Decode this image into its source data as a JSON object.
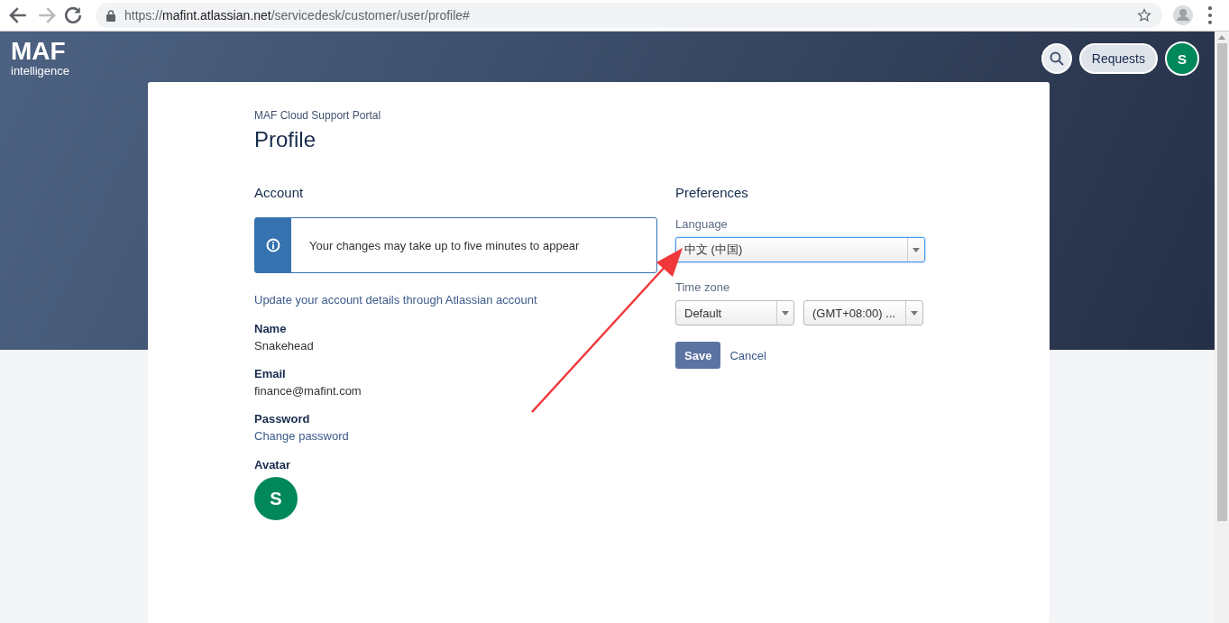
{
  "browser": {
    "url": {
      "scheme": "https://",
      "host": "mafint.atlassian.net",
      "path": "/servicedesk/customer/user/profile#"
    }
  },
  "header": {
    "logo": {
      "mark": "MAF",
      "tagline": "intelligence"
    },
    "requests_button": "Requests",
    "avatar_initial": "S"
  },
  "card": {
    "portal_name": "MAF Cloud Support Portal",
    "title": "Profile",
    "account": {
      "heading": "Account",
      "notice": "Your changes may take up to five minutes to appear",
      "update_link": "Update your account details through Atlassian account",
      "fields": [
        {
          "kind": "text",
          "label": "Name",
          "value": "Snakehead"
        },
        {
          "kind": "text",
          "label": "Email",
          "value": "finance@mafint.com"
        },
        {
          "kind": "link",
          "label": "Password",
          "value": "Change password"
        },
        {
          "kind": "avatar",
          "label": "Avatar",
          "value": "S"
        }
      ]
    },
    "preferences": {
      "heading": "Preferences",
      "language": {
        "label": "Language",
        "value": "中文 (中国)",
        "focused": true
      },
      "time_zone": {
        "label": "Time zone",
        "region": "Default",
        "zone": "(GMT+08:00) ..."
      },
      "save_button": "Save",
      "cancel_link": "Cancel"
    }
  },
  "annotation": {
    "kind": "arrow"
  }
}
